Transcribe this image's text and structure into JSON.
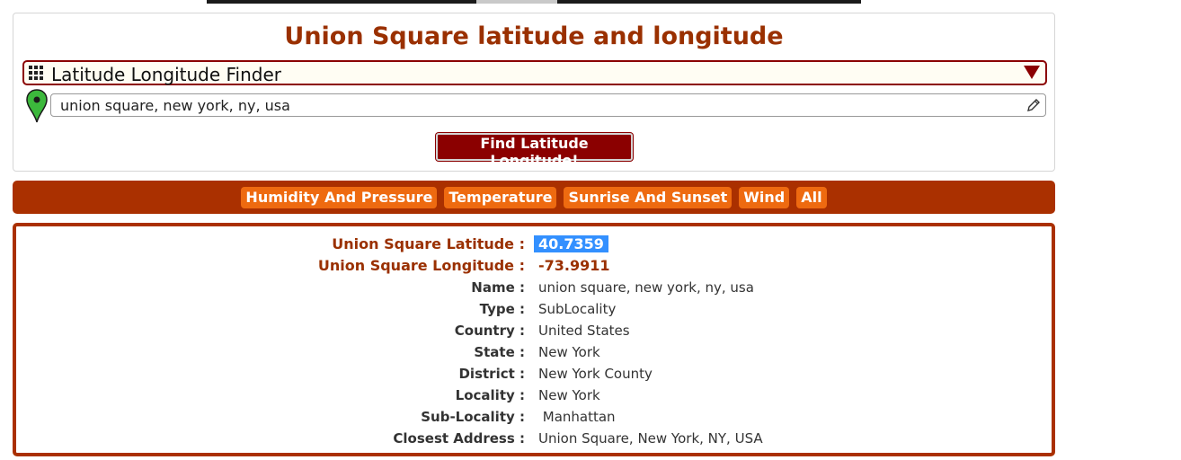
{
  "page_title": "Union Square latitude and longitude",
  "tool_select": {
    "label": "Latitude Longitude Finder",
    "icon": "grid-icon"
  },
  "search": {
    "value": "union square, new york, ny, usa",
    "icon": "map-pin-icon",
    "edit_icon": "pencil-icon"
  },
  "find_button_label": "Find Latitude Longitude!",
  "tabs": [
    {
      "label": "Humidity And Pressure"
    },
    {
      "label": "Temperature"
    },
    {
      "label": "Sunrise And Sunset"
    },
    {
      "label": "Wind"
    },
    {
      "label": "All"
    }
  ],
  "results": {
    "latitude": {
      "label": "Union Square Latitude :",
      "value": "40.7359"
    },
    "longitude": {
      "label": "Union Square Longitude :",
      "value": "-73.9911"
    },
    "details": [
      {
        "label": "Name :",
        "value": "union square, new york, ny, usa"
      },
      {
        "label": "Type :",
        "value": "SubLocality"
      },
      {
        "label": "Country :",
        "value": "United States"
      },
      {
        "label": "State :",
        "value": "New York"
      },
      {
        "label": "District :",
        "value": "New York County"
      },
      {
        "label": "Locality :",
        "value": "New York"
      },
      {
        "label": "Sub-Locality :",
        "value": " Manhattan"
      },
      {
        "label": "Closest Address :",
        "value": "Union Square, New York, NY, USA"
      }
    ]
  },
  "colors": {
    "title": "#9a3000",
    "button": "#8b0000",
    "tab_bar": "#aa3000",
    "tab": "#ee6a10",
    "selection": "#3390ff"
  }
}
